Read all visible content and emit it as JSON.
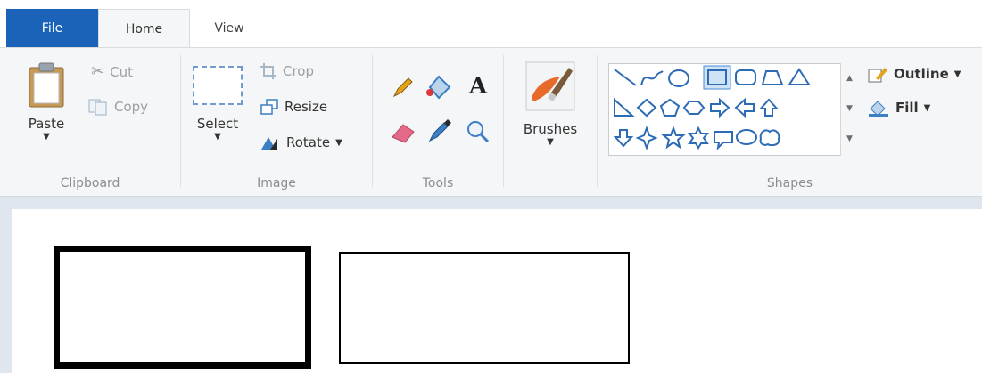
{
  "tabs": {
    "file": "File",
    "home": "Home",
    "view": "View"
  },
  "clipboard": {
    "label": "Clipboard",
    "paste": "Paste",
    "cut": "Cut",
    "copy": "Copy"
  },
  "image": {
    "label": "Image",
    "select": "Select",
    "crop": "Crop",
    "resize": "Resize",
    "rotate": "Rotate"
  },
  "tools": {
    "label": "Tools"
  },
  "brushes": {
    "label": "Brushes"
  },
  "shapes": {
    "label": "Shapes",
    "outline": "Outline",
    "fill": "Fill"
  },
  "colors": {
    "file_tab": "#1a63b8",
    "outline_icon": "#e3a21a",
    "fill_icon": "#3d7fc4"
  }
}
